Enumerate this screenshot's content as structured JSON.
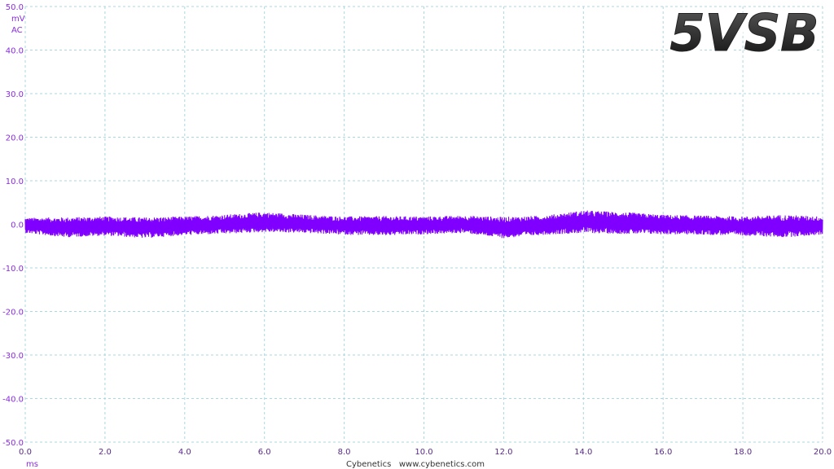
{
  "rail_label": "5VSB",
  "y_unit": "mV",
  "coupling": "AC",
  "x_unit": "ms",
  "footer": "Cybenetics   www.cybenetics.com",
  "colors": {
    "trace": "#8000ff",
    "grid": "#a8d8e0",
    "y_labels": "#8a2be2",
    "x_labels": "#5a2a8a"
  },
  "chart_data": {
    "type": "line",
    "title": "5VSB",
    "xlabel": "ms",
    "ylabel": "mV",
    "xlim": [
      0,
      20
    ],
    "ylim": [
      -50,
      50
    ],
    "grid": true,
    "x_ticks": [
      "0.0",
      "2.0",
      "4.0",
      "6.0",
      "8.0",
      "10.0",
      "12.0",
      "14.0",
      "16.0",
      "18.0",
      "20.0"
    ],
    "y_ticks": [
      "50.0",
      "40.0",
      "30.0",
      "20.0",
      "10.0",
      "0.0",
      "-10.0",
      "-20.0",
      "-30.0",
      "-40.0",
      "-50.0"
    ],
    "series": [
      {
        "x": [
          0,
          1,
          2,
          3,
          4,
          5,
          6,
          7,
          8,
          9,
          10,
          11,
          12,
          13,
          14,
          15,
          16,
          17,
          18,
          19,
          20
        ],
        "y_max": [
          1.5,
          1.6,
          1.8,
          1.6,
          1.8,
          2.2,
          2.8,
          2.2,
          1.8,
          1.9,
          1.8,
          2.0,
          1.7,
          2.0,
          3.2,
          2.8,
          2.2,
          2.0,
          1.8,
          2.2,
          1.8
        ],
        "y_min": [
          -2.0,
          -3.0,
          -2.6,
          -3.2,
          -2.5,
          -2.2,
          -1.8,
          -2.0,
          -2.4,
          -2.6,
          -2.3,
          -2.0,
          -3.2,
          -2.4,
          -2.0,
          -2.2,
          -2.3,
          -2.4,
          -2.6,
          -3.0,
          -2.4
        ]
      }
    ]
  }
}
